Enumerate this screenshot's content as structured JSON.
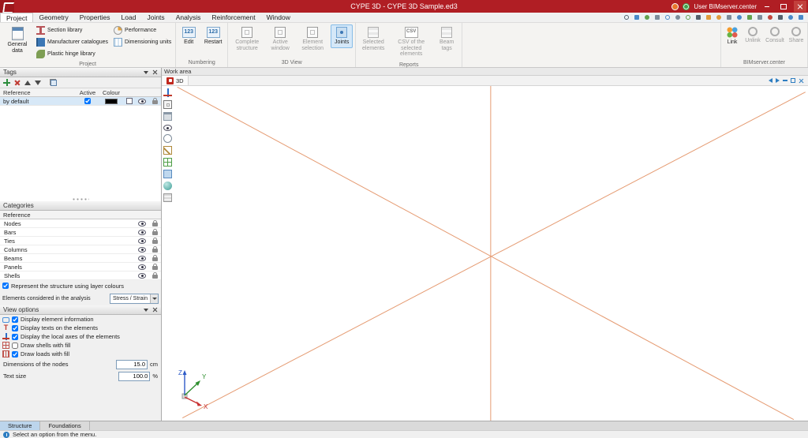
{
  "titlebar": {
    "title": "CYPE 3D - CYPE 3D Sample.ed3",
    "user_label": "User BIMserver.center"
  },
  "menubar": {
    "items": [
      "Project",
      "Geometry",
      "Properties",
      "Load",
      "Joints",
      "Analysis",
      "Reinforcement",
      "Window"
    ],
    "icons": [
      "search",
      "print",
      "redraw",
      "pan",
      "zoom-window",
      "previous-zoom",
      "orbit",
      "front-view",
      "perspective",
      "sun",
      "measure",
      "dimension",
      "layers",
      "grid",
      "detail",
      "lock",
      "references",
      "windows"
    ]
  },
  "ribbon": {
    "project": {
      "caption": "Project",
      "general_data": "General data",
      "section_library": "Section library",
      "manufacturer_catalogues": "Manufacturer catalogues",
      "plastic_hinge_library": "Plastic hinge library",
      "performance": "Performance",
      "dimensioning_units": "Dimensioning units"
    },
    "numbering": {
      "caption": "Numbering",
      "icon_glyph": "123",
      "edit": "Edit",
      "restart": "Restart"
    },
    "view3d": {
      "caption": "3D View",
      "complete_structure": "Complete structure",
      "active_window": "Active window",
      "element_selection": "Element selection",
      "joints": "Joints"
    },
    "reports": {
      "caption": "Reports",
      "csv_icon": "CSV",
      "selected_elements": "Selected elements",
      "csv_selected": "CSV of the selected elements",
      "beam_tags": "Beam tags"
    },
    "bimserver": {
      "caption": "BIMserver.center",
      "link": "Link",
      "unlink": "Unlink",
      "consult": "Consult",
      "share": "Share"
    }
  },
  "tags_panel": {
    "title": "Tags",
    "columns": {
      "reference": "Reference",
      "active": "Active",
      "colour": "Colour"
    },
    "rows": [
      {
        "reference": "by default",
        "active": true,
        "colour": "#000000"
      }
    ]
  },
  "categories_panel": {
    "title": "Categories",
    "column_header": "Reference",
    "rows": [
      {
        "label": "Nodes"
      },
      {
        "label": "Bars"
      },
      {
        "label": "Ties"
      },
      {
        "label": "Columns"
      },
      {
        "label": "Beams"
      },
      {
        "label": "Panels"
      },
      {
        "label": "Shells"
      }
    ],
    "layer_colours_label": "Represent the structure using layer colours",
    "layer_colours_checked": true,
    "elements_label": "Elements considered in the analysis",
    "elements_value": "Stress / Strain"
  },
  "view_options": {
    "title": "View options",
    "options": [
      {
        "label": "Display element information",
        "checked": true
      },
      {
        "label": "Display texts on the elements",
        "checked": true,
        "icon_glyph": "T"
      },
      {
        "label": "Display the local axes of the elements",
        "checked": true
      },
      {
        "label": "Draw shells with fill",
        "checked": false
      },
      {
        "label": "Draw loads with fill",
        "checked": true
      }
    ],
    "node_dimensions_label": "Dimensions of the nodes",
    "node_dimensions_value": "15.0",
    "node_dimensions_unit": "cm",
    "text_size_label": "Text size",
    "text_size_value": "100.0",
    "text_size_unit": "%"
  },
  "workarea": {
    "title": "Work area",
    "tab_label": "3D",
    "tools": [
      "local-axes",
      "views-cube",
      "printer",
      "visibility",
      "orbit",
      "measure",
      "grid",
      "texture",
      "sphere",
      "tags"
    ],
    "axis": {
      "x": "X",
      "y": "Y",
      "z": "Z"
    }
  },
  "bottom_tabs": {
    "structure": "Structure",
    "foundations": "Foundations"
  },
  "statusbar": {
    "message": "Select an option from the menu."
  },
  "colors": {
    "titlebar_bg": "#B01E24",
    "canvas_line": "#E59B72",
    "selection_bg": "#D5E8F8",
    "accent_blue": "#2D7DC1"
  }
}
